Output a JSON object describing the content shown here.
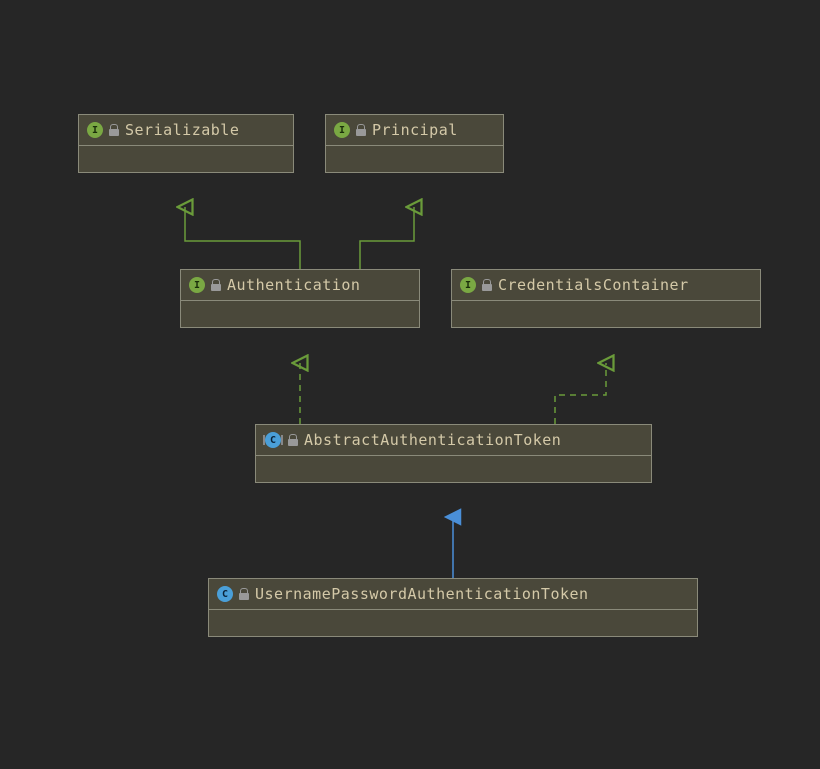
{
  "nodes": {
    "serializable": {
      "label": "Serializable",
      "type": "interface"
    },
    "principal": {
      "label": "Principal",
      "type": "interface"
    },
    "authentication": {
      "label": "Authentication",
      "type": "interface"
    },
    "credentialsContainer": {
      "label": "CredentialsContainer",
      "type": "interface"
    },
    "abstractAuthToken": {
      "label": "AbstractAuthenticationToken",
      "type": "abstract-class"
    },
    "usernamePasswordAuthToken": {
      "label": "UsernamePasswordAuthenticationToken",
      "type": "class"
    }
  },
  "icons": {
    "interface": "I",
    "class": "C"
  },
  "colors": {
    "background": "#262626",
    "nodeBg": "#4a483a",
    "nodeBorder": "#8a8a7a",
    "text": "#d4c9a8",
    "interfaceGreen": "#7aa843",
    "classBlue": "#4a9fd8",
    "arrowGreen": "#6a9b3a",
    "arrowBlue": "#4a8fd8"
  },
  "relations": [
    {
      "from": "authentication",
      "to": "serializable",
      "style": "solid-green"
    },
    {
      "from": "authentication",
      "to": "principal",
      "style": "solid-green"
    },
    {
      "from": "abstractAuthToken",
      "to": "authentication",
      "style": "dashed-green"
    },
    {
      "from": "abstractAuthToken",
      "to": "credentialsContainer",
      "style": "dashed-green"
    },
    {
      "from": "usernamePasswordAuthToken",
      "to": "abstractAuthToken",
      "style": "solid-blue"
    }
  ]
}
